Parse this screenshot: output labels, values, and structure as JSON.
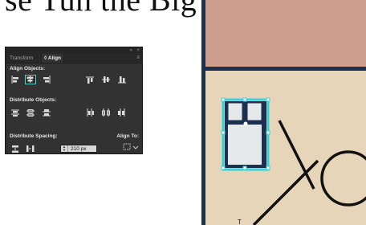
{
  "top_text": "se Tun the Big Ge tet",
  "panel": {
    "collapse_icon": "«",
    "close_icon": "×",
    "tabs": [
      {
        "label": "Transform",
        "active": false
      },
      {
        "label": "◊ Align",
        "active": true
      }
    ],
    "menu_icon": "≡",
    "sections": {
      "align_objects": "Align Objects:",
      "distribute_objects": "Distribute Objects:",
      "distribute_spacing": "Distribute Spacing:",
      "align_to": "Align To:"
    },
    "spacing_value": "210 px",
    "selected_button": "align-horizontal-center",
    "accent_color": "#4fd1d4"
  },
  "artboard": {
    "letters": [
      "T",
      "O"
    ],
    "colors": {
      "background": "#e6d5b8",
      "top_block": "#cd9d90",
      "frame": "#1d3050",
      "selection": "#37d3dd",
      "letters": "#111111"
    }
  }
}
